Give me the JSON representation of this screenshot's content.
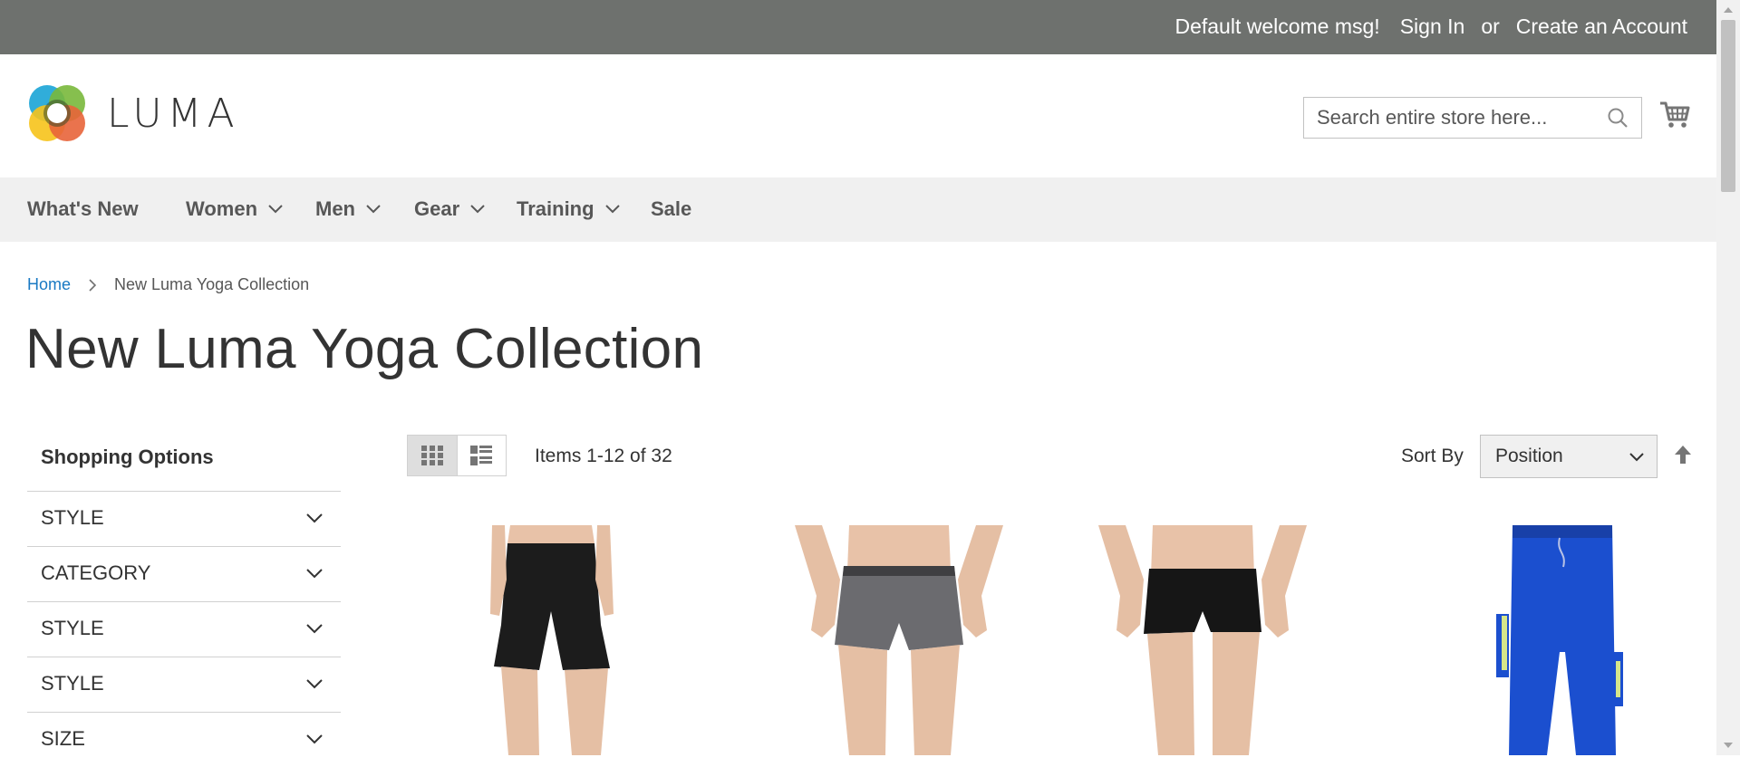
{
  "topbar": {
    "welcome": "Default welcome msg!",
    "sign_in": "Sign In",
    "or": "or",
    "create_account": "Create an Account"
  },
  "header": {
    "logo_text": "LUMA",
    "search_placeholder": "Search entire store here..."
  },
  "nav": {
    "items": [
      {
        "label": "What's New"
      },
      {
        "label": "Women"
      },
      {
        "label": "Men"
      },
      {
        "label": "Gear"
      },
      {
        "label": "Training"
      },
      {
        "label": "Sale"
      }
    ]
  },
  "breadcrumb": {
    "home": "Home",
    "current": "New Luma Yoga Collection"
  },
  "page_title": "New Luma Yoga Collection",
  "sidebar": {
    "title": "Shopping Options",
    "filters": [
      {
        "label": "STYLE"
      },
      {
        "label": "CATEGORY"
      },
      {
        "label": "STYLE"
      },
      {
        "label": "STYLE"
      },
      {
        "label": "SIZE"
      }
    ]
  },
  "toolbar": {
    "amount": "Items 1-12 of 32",
    "sort_label": "Sort By",
    "sort_value": "Position"
  },
  "colors": {
    "topbar_bg": "#6e716e",
    "nav_bg": "#f0f0f0",
    "link": "#1979c3"
  }
}
